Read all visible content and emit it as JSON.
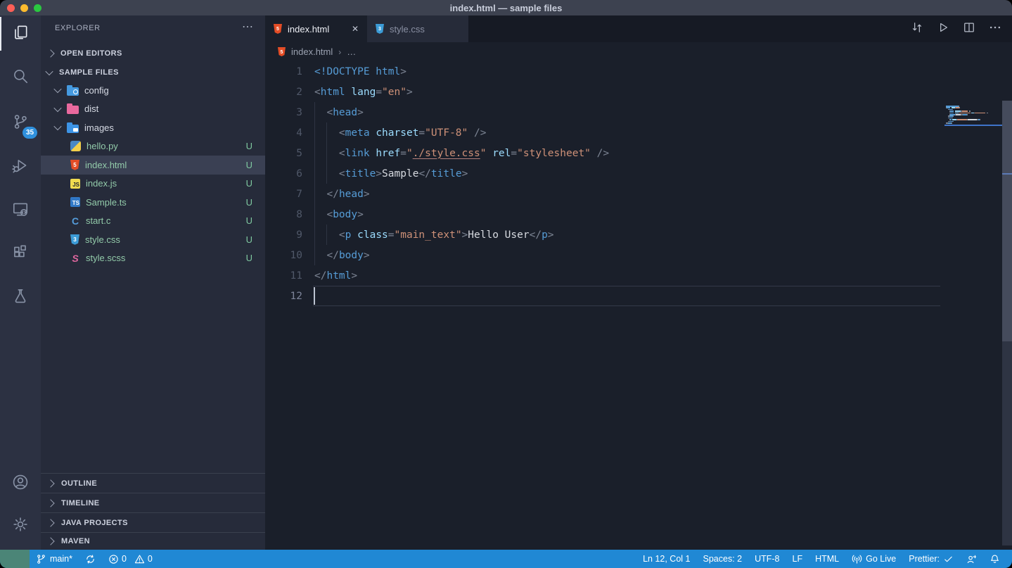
{
  "window": {
    "title": "index.html — sample files"
  },
  "colors": {
    "status_bar": "#2088d4",
    "remote_indicator": "#4b8577",
    "activity_badge": "#2f90dd",
    "untracked_green": "#93cbaa",
    "html_icon_orange": "#e44d26",
    "css_icon_blue": "#3c9cd7",
    "minimap_current_line": "#3f74c9",
    "traffic_lights": [
      "#ff5f57",
      "#febc2e",
      "#2ac840"
    ]
  },
  "activity_bar": {
    "items": [
      {
        "id": "explorer",
        "label": "Explorer",
        "active": true
      },
      {
        "id": "search",
        "label": "Search",
        "active": false
      },
      {
        "id": "source-control",
        "label": "Source Control",
        "active": false,
        "badge": "35"
      },
      {
        "id": "run-debug",
        "label": "Run and Debug",
        "active": false
      },
      {
        "id": "remote-explorer",
        "label": "Remote Explorer",
        "active": false
      },
      {
        "id": "extensions",
        "label": "Extensions",
        "active": false
      },
      {
        "id": "testing",
        "label": "Testing",
        "active": false
      }
    ],
    "bottom_items": [
      {
        "id": "accounts",
        "label": "Accounts"
      },
      {
        "id": "manage",
        "label": "Manage"
      }
    ]
  },
  "sidebar": {
    "title": "EXPLORER",
    "more_actions": "⋯",
    "open_editors_label": "OPEN EDITORS",
    "root_label": "SAMPLE FILES",
    "tree": [
      {
        "kind": "folder",
        "icon": "folder-config",
        "name": "config",
        "expanded": true
      },
      {
        "kind": "folder",
        "icon": "folder-dist",
        "name": "dist",
        "expanded": true
      },
      {
        "kind": "folder",
        "icon": "folder-images",
        "name": "images",
        "expanded": true
      },
      {
        "kind": "file",
        "icon": "python",
        "name": "hello.py",
        "badge": "U"
      },
      {
        "kind": "file",
        "icon": "html",
        "name": "index.html",
        "badge": "U",
        "selected": true
      },
      {
        "kind": "file",
        "icon": "js",
        "name": "index.js",
        "badge": "U"
      },
      {
        "kind": "file",
        "icon": "ts",
        "name": "Sample.ts",
        "badge": "U"
      },
      {
        "kind": "file",
        "icon": "c",
        "name": "start.c",
        "badge": "U"
      },
      {
        "kind": "file",
        "icon": "css",
        "name": "style.css",
        "badge": "U"
      },
      {
        "kind": "file",
        "icon": "scss",
        "name": "style.scss",
        "badge": "U"
      }
    ],
    "bottom_sections": [
      {
        "label": "OUTLINE"
      },
      {
        "label": "TIMELINE"
      },
      {
        "label": "JAVA PROJECTS"
      },
      {
        "label": "MAVEN"
      }
    ]
  },
  "editor": {
    "tabs": [
      {
        "label": "index.html",
        "icon": "html",
        "active": true,
        "close_label": "✕"
      },
      {
        "label": "style.css",
        "icon": "css",
        "active": false
      }
    ],
    "actions": [
      {
        "id": "open-changes",
        "label": "Open Changes"
      },
      {
        "id": "run",
        "label": "Run"
      },
      {
        "id": "split-editor",
        "label": "Split Editor"
      },
      {
        "id": "more-actions",
        "label": "More Actions"
      }
    ],
    "breadcrumb": {
      "icon": "html",
      "file": "index.html",
      "separator": "›",
      "more": "…"
    },
    "cursor_line": 12,
    "lines": [
      {
        "num": "1",
        "segs": [
          [
            "tag",
            "<!DOCTYPE html"
          ],
          [
            "punct",
            ">"
          ]
        ]
      },
      {
        "num": "2",
        "segs": [
          [
            "punct",
            "<"
          ],
          [
            "tag",
            "html"
          ],
          [
            "plain",
            " "
          ],
          [
            "attr",
            "lang"
          ],
          [
            "punct",
            "="
          ],
          [
            "str",
            "\"en\""
          ],
          [
            "punct",
            ">"
          ]
        ]
      },
      {
        "num": "3",
        "segs": [
          [
            "plain",
            "  "
          ],
          [
            "punct",
            "<"
          ],
          [
            "tag",
            "head"
          ],
          [
            "punct",
            ">"
          ]
        ]
      },
      {
        "num": "4",
        "segs": [
          [
            "plain",
            "    "
          ],
          [
            "punct",
            "<"
          ],
          [
            "tag",
            "meta"
          ],
          [
            "plain",
            " "
          ],
          [
            "attr",
            "charset"
          ],
          [
            "punct",
            "="
          ],
          [
            "str",
            "\"UTF-8\""
          ],
          [
            "plain",
            " "
          ],
          [
            "punct",
            "/>"
          ]
        ]
      },
      {
        "num": "5",
        "segs": [
          [
            "plain",
            "    "
          ],
          [
            "punct",
            "<"
          ],
          [
            "tag",
            "link"
          ],
          [
            "plain",
            " "
          ],
          [
            "attr",
            "href"
          ],
          [
            "punct",
            "="
          ],
          [
            "str",
            "\""
          ],
          [
            "link",
            "./style.css"
          ],
          [
            "str",
            "\""
          ],
          [
            "plain",
            " "
          ],
          [
            "attr",
            "rel"
          ],
          [
            "punct",
            "="
          ],
          [
            "str",
            "\"stylesheet\""
          ],
          [
            "plain",
            " "
          ],
          [
            "punct",
            "/>"
          ]
        ]
      },
      {
        "num": "6",
        "segs": [
          [
            "plain",
            "    "
          ],
          [
            "punct",
            "<"
          ],
          [
            "tag",
            "title"
          ],
          [
            "punct",
            ">"
          ],
          [
            "text",
            "Sample"
          ],
          [
            "punct",
            "</"
          ],
          [
            "tag",
            "title"
          ],
          [
            "punct",
            ">"
          ]
        ]
      },
      {
        "num": "7",
        "segs": [
          [
            "plain",
            "  "
          ],
          [
            "punct",
            "</"
          ],
          [
            "tag",
            "head"
          ],
          [
            "punct",
            ">"
          ]
        ]
      },
      {
        "num": "8",
        "segs": [
          [
            "plain",
            "  "
          ],
          [
            "punct",
            "<"
          ],
          [
            "tag",
            "body"
          ],
          [
            "punct",
            ">"
          ]
        ]
      },
      {
        "num": "9",
        "segs": [
          [
            "plain",
            "    "
          ],
          [
            "punct",
            "<"
          ],
          [
            "tag",
            "p"
          ],
          [
            "plain",
            " "
          ],
          [
            "attr",
            "class"
          ],
          [
            "punct",
            "="
          ],
          [
            "str",
            "\"main_text\""
          ],
          [
            "punct",
            ">"
          ],
          [
            "text",
            "Hello User"
          ],
          [
            "punct",
            "</"
          ],
          [
            "tag",
            "p"
          ],
          [
            "punct",
            ">"
          ]
        ]
      },
      {
        "num": "10",
        "segs": [
          [
            "plain",
            "  "
          ],
          [
            "punct",
            "</"
          ],
          [
            "tag",
            "body"
          ],
          [
            "punct",
            ">"
          ]
        ]
      },
      {
        "num": "11",
        "segs": [
          [
            "punct",
            "</"
          ],
          [
            "tag",
            "html"
          ],
          [
            "punct",
            ">"
          ]
        ]
      },
      {
        "num": "12",
        "segs": []
      }
    ]
  },
  "status_bar": {
    "remote": {
      "id": "remote",
      "label": ""
    },
    "left_items": [
      {
        "id": "branch",
        "icon": "branch",
        "label": "main*"
      },
      {
        "id": "sync",
        "icon": "sync",
        "label": ""
      },
      {
        "id": "problems",
        "parts": [
          [
            "error",
            "0"
          ],
          [
            "warning",
            "0"
          ]
        ]
      }
    ],
    "right_items": [
      {
        "id": "cursor-position",
        "label": "Ln 12, Col 1"
      },
      {
        "id": "indentation",
        "label": "Spaces: 2"
      },
      {
        "id": "encoding",
        "label": "UTF-8"
      },
      {
        "id": "eol",
        "label": "LF"
      },
      {
        "id": "language-mode",
        "label": "HTML"
      },
      {
        "id": "go-live",
        "icon": "broadcast",
        "label": "Go Live"
      },
      {
        "id": "prettier",
        "label": "Prettier:",
        "icon_after": "check"
      },
      {
        "id": "feedback",
        "icon": "feedback",
        "label": ""
      },
      {
        "id": "notifications",
        "icon": "bell",
        "label": ""
      }
    ]
  }
}
